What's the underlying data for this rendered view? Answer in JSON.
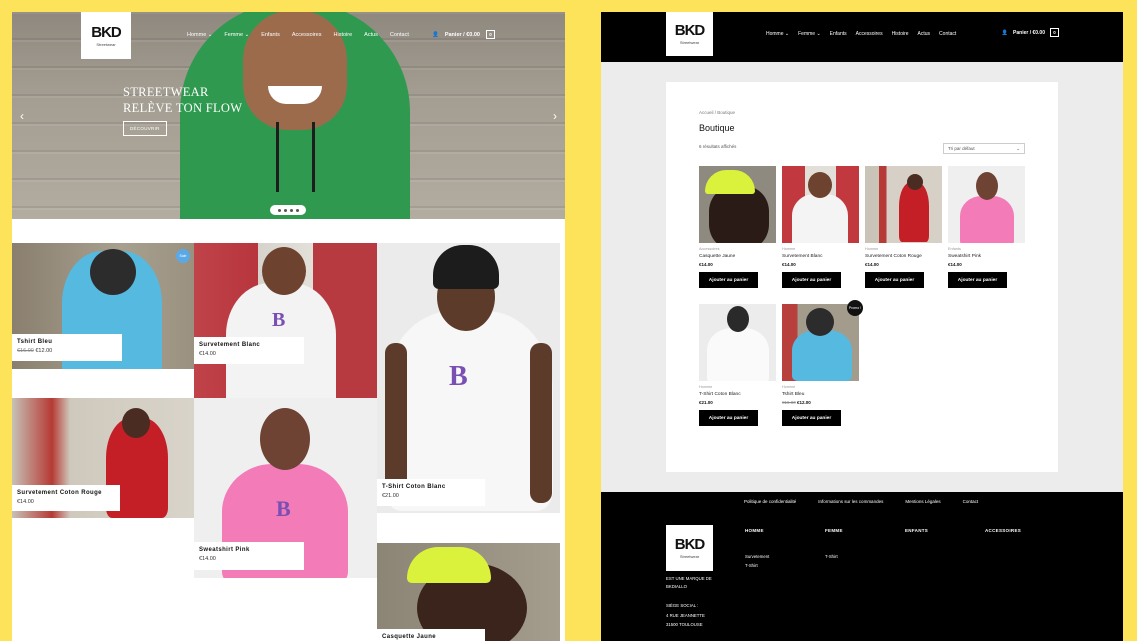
{
  "brand": {
    "logo_text": "BKD",
    "logo_sub": "Streetwear"
  },
  "nav": {
    "items": [
      "Homme",
      "Femme",
      "Enfants",
      "Accessoires",
      "Histoire",
      "Actus",
      "Contact"
    ],
    "cart_label": "Panier / €0.00",
    "cart_count": "0"
  },
  "hero": {
    "title_line1": "STREETWEAR",
    "title_line2": "RELÈVE TON FLOW",
    "cta": "DÉCOUVRIR"
  },
  "grid": [
    {
      "name": "Tshirt Bleu",
      "old_price": "€16.00",
      "price": "€12.00",
      "badge": "Sale"
    },
    {
      "name": "Survetement Blanc",
      "price": "€14.00"
    },
    {
      "name": "T-Shirt Coton Blanc",
      "price": "€21.00"
    },
    {
      "name": "Survetement Coton Rouge",
      "price": "€14.00"
    },
    {
      "name": "Sweatshirt Pink",
      "price": "€14.00"
    },
    {
      "name": "Casquette Jaune",
      "price": ""
    }
  ],
  "shop": {
    "breadcrumb": "Accueil / Boutique",
    "title": "Boutique",
    "results": "6 résultats affichés",
    "sort": "Tri par défaut",
    "add_to_cart": "Ajouter au panier",
    "products": [
      {
        "cat": "Accessoires",
        "name": "Casquette Jaune",
        "price": "€14.00"
      },
      {
        "cat": "Homme",
        "name": "Survetement Blanc",
        "price": "€14.00"
      },
      {
        "cat": "Homme",
        "name": "Survetement Coton Rouge",
        "price": "€14.00"
      },
      {
        "cat": "Enfants",
        "name": "Sweatshirt Pink",
        "price": "€14.00"
      },
      {
        "cat": "Homme",
        "name": "T-Shirt Coton Blanc",
        "price": "€21.00"
      },
      {
        "cat": "Homme",
        "name": "Tshirt Bleu",
        "old_price": "€16.00",
        "price": "€12.00",
        "badge": "Promo !"
      }
    ]
  },
  "footer": {
    "links": [
      "Politique de confidentialité",
      "Informations sur les commandes",
      "Mentions Légales",
      "Contact"
    ],
    "brand_line1": "EST UNE MARQUE DE",
    "brand_line2": "BKDIALLO",
    "address": [
      "SIÈGE SOCIAL :",
      "4 RUE JEANNETTE",
      "31500 TOULOUSE"
    ],
    "columns": [
      {
        "title": "HOMME",
        "items": [
          "Survetement",
          "T-Shirt"
        ]
      },
      {
        "title": "FEMME",
        "items": [
          "T-Shirt"
        ]
      },
      {
        "title": "ENFANTS",
        "items": []
      },
      {
        "title": "ACCESSOIRES",
        "items": []
      }
    ]
  },
  "colors": {
    "background": "#fde35a",
    "hood_green": "#2f9a4f",
    "black": "#000000"
  }
}
